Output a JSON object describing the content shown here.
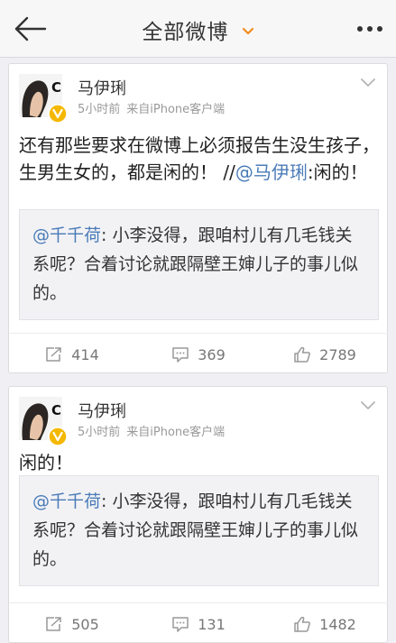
{
  "nav": {
    "title": "全部微博"
  },
  "posts": [
    {
      "username": "马伊琍",
      "time": "5小时前",
      "source": "来自iPhone客户端",
      "text_main": "还有那些要求在微博上必须报告生没生孩子，生男生女的，都是闲的！ //",
      "text_mention": "@马伊琍",
      "text_tail": ":闲的！",
      "repost_mention": "@千千荷",
      "repost_text": ": 小李没得，跟咱村儿有几毛钱关系呢？合着讨论就跟隔壁王婶儿子的事儿似的。",
      "reposts": "414",
      "comments": "369",
      "likes": "2789"
    },
    {
      "username": "马伊琍",
      "time": "5小时前",
      "source": "来自iPhone客户端",
      "text_main": "闲的！",
      "repost_mention": "@千千荷",
      "repost_text": ": 小李没得，跟咱村儿有几毛钱关系呢？合着讨论就跟隔壁王婶儿子的事儿似的。",
      "reposts": "505",
      "comments": "131",
      "likes": "1482"
    }
  ],
  "colors": {
    "link": "#4a7bb7",
    "accent": "#f08c1e",
    "badge": "#f5b800"
  },
  "icons": [
    "back-arrow-icon",
    "dropdown-chevron-icon",
    "more-dots-icon",
    "verified-badge-icon",
    "card-menu-chevron-icon",
    "repost-icon",
    "comment-icon",
    "like-icon"
  ]
}
